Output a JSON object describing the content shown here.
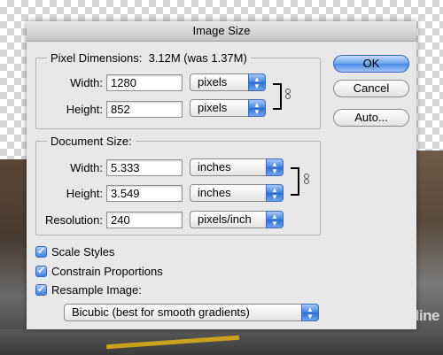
{
  "dialog": {
    "title": "Image Size",
    "buttons": {
      "ok": "OK",
      "cancel": "Cancel",
      "auto": "Auto..."
    }
  },
  "pixel_dimensions": {
    "legend": "Pixel Dimensions:",
    "size_text": "3.12M (was 1.37M)",
    "width_label": "Width:",
    "width_value": "1280",
    "width_unit": "pixels",
    "height_label": "Height:",
    "height_value": "852",
    "height_unit": "pixels"
  },
  "document_size": {
    "legend": "Document Size:",
    "width_label": "Width:",
    "width_value": "5.333",
    "width_unit": "inches",
    "height_label": "Height:",
    "height_value": "3.549",
    "height_unit": "inches",
    "resolution_label": "Resolution:",
    "resolution_value": "240",
    "resolution_unit": "pixels/inch"
  },
  "options": {
    "scale_styles": {
      "label": "Scale Styles",
      "checked": true
    },
    "constrain_proportions": {
      "label": "Constrain Proportions",
      "checked": true
    },
    "resample_image": {
      "label": "Resample Image:",
      "checked": true
    },
    "resample_method": "Bicubic (best for smooth gradients)"
  },
  "watermark": "PConline",
  "colors": {
    "accent": "#3d82e0",
    "dialog_bg": "#e8e8e8"
  },
  "icons": [
    "link-chain-icon",
    "popup-arrows-icon",
    "checkmark-icon"
  ]
}
